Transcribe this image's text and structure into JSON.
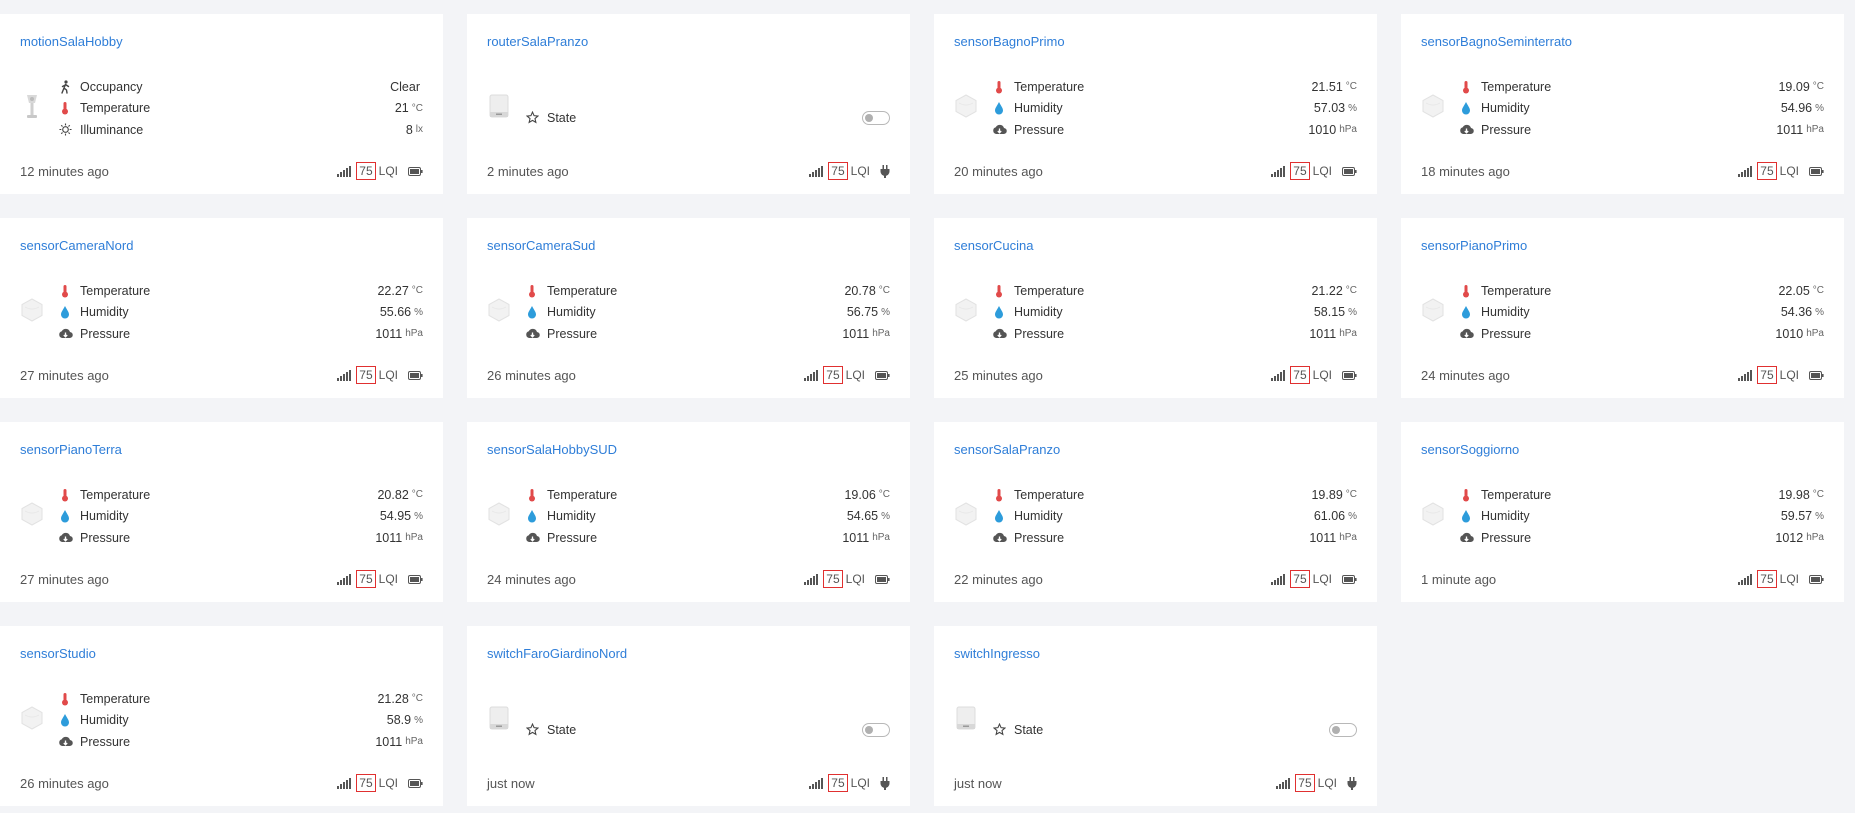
{
  "lqi_label": "LQI",
  "colors": {
    "link": "#2f7ed8",
    "thermo": "#e14a4a",
    "drop": "#2d9cdb",
    "highlight": "#e03030"
  },
  "cards": [
    {
      "title": "motionSalaHobby",
      "image": "motion-sensor",
      "power": "battery",
      "time": "12 minutes ago",
      "lqi": "75",
      "props": [
        {
          "icon": "walking-person-icon",
          "label": "Occupancy",
          "value": "Clear",
          "unit": ""
        },
        {
          "icon": "thermometer-icon",
          "label": "Temperature",
          "value": "21",
          "unit": "°C"
        },
        {
          "icon": "sun-icon",
          "label": "Illuminance",
          "value": "8",
          "unit": "lx"
        }
      ]
    },
    {
      "title": "routerSalaPranzo",
      "image": "router",
      "power": "plug",
      "time": "2 minutes ago",
      "lqi": "75",
      "props": [
        {
          "icon": "star-icon",
          "label": "State",
          "toggle": true
        }
      ]
    },
    {
      "title": "sensorBagnoPrimo",
      "image": "climate-sensor",
      "power": "battery",
      "time": "20 minutes ago",
      "lqi": "75",
      "props": [
        {
          "icon": "thermometer-icon",
          "label": "Temperature",
          "value": "21.51",
          "unit": "°C"
        },
        {
          "icon": "drop-icon",
          "label": "Humidity",
          "value": "57.03",
          "unit": "%"
        },
        {
          "icon": "cloud-download-icon",
          "label": "Pressure",
          "value": "1010",
          "unit": "hPa"
        }
      ]
    },
    {
      "title": "sensorBagnoSeminterrato",
      "image": "climate-sensor",
      "power": "battery",
      "time": "18 minutes ago",
      "lqi": "75",
      "props": [
        {
          "icon": "thermometer-icon",
          "label": "Temperature",
          "value": "19.09",
          "unit": "°C"
        },
        {
          "icon": "drop-icon",
          "label": "Humidity",
          "value": "54.96",
          "unit": "%"
        },
        {
          "icon": "cloud-download-icon",
          "label": "Pressure",
          "value": "1011",
          "unit": "hPa"
        }
      ]
    },
    {
      "title": "sensorCameraNord",
      "image": "climate-sensor",
      "power": "battery",
      "time": "27 minutes ago",
      "lqi": "75",
      "props": [
        {
          "icon": "thermometer-icon",
          "label": "Temperature",
          "value": "22.27",
          "unit": "°C"
        },
        {
          "icon": "drop-icon",
          "label": "Humidity",
          "value": "55.66",
          "unit": "%"
        },
        {
          "icon": "cloud-download-icon",
          "label": "Pressure",
          "value": "1011",
          "unit": "hPa"
        }
      ]
    },
    {
      "title": "sensorCameraSud",
      "image": "climate-sensor",
      "power": "battery",
      "time": "26 minutes ago",
      "lqi": "75",
      "props": [
        {
          "icon": "thermometer-icon",
          "label": "Temperature",
          "value": "20.78",
          "unit": "°C"
        },
        {
          "icon": "drop-icon",
          "label": "Humidity",
          "value": "56.75",
          "unit": "%"
        },
        {
          "icon": "cloud-download-icon",
          "label": "Pressure",
          "value": "1011",
          "unit": "hPa"
        }
      ]
    },
    {
      "title": "sensorCucina",
      "image": "climate-sensor",
      "power": "battery",
      "time": "25 minutes ago",
      "lqi": "75",
      "props": [
        {
          "icon": "thermometer-icon",
          "label": "Temperature",
          "value": "21.22",
          "unit": "°C"
        },
        {
          "icon": "drop-icon",
          "label": "Humidity",
          "value": "58.15",
          "unit": "%"
        },
        {
          "icon": "cloud-download-icon",
          "label": "Pressure",
          "value": "1011",
          "unit": "hPa"
        }
      ]
    },
    {
      "title": "sensorPianoPrimo",
      "image": "climate-sensor",
      "power": "battery",
      "time": "24 minutes ago",
      "lqi": "75",
      "props": [
        {
          "icon": "thermometer-icon",
          "label": "Temperature",
          "value": "22.05",
          "unit": "°C"
        },
        {
          "icon": "drop-icon",
          "label": "Humidity",
          "value": "54.36",
          "unit": "%"
        },
        {
          "icon": "cloud-download-icon",
          "label": "Pressure",
          "value": "1010",
          "unit": "hPa"
        }
      ]
    },
    {
      "title": "sensorPianoTerra",
      "image": "climate-sensor",
      "power": "battery",
      "time": "27 minutes ago",
      "lqi": "75",
      "props": [
        {
          "icon": "thermometer-icon",
          "label": "Temperature",
          "value": "20.82",
          "unit": "°C"
        },
        {
          "icon": "drop-icon",
          "label": "Humidity",
          "value": "54.95",
          "unit": "%"
        },
        {
          "icon": "cloud-download-icon",
          "label": "Pressure",
          "value": "1011",
          "unit": "hPa"
        }
      ]
    },
    {
      "title": "sensorSalaHobbySUD",
      "image": "climate-sensor",
      "power": "battery",
      "time": "24 minutes ago",
      "lqi": "75",
      "props": [
        {
          "icon": "thermometer-icon",
          "label": "Temperature",
          "value": "19.06",
          "unit": "°C"
        },
        {
          "icon": "drop-icon",
          "label": "Humidity",
          "value": "54.65",
          "unit": "%"
        },
        {
          "icon": "cloud-download-icon",
          "label": "Pressure",
          "value": "1011",
          "unit": "hPa"
        }
      ]
    },
    {
      "title": "sensorSalaPranzo",
      "image": "climate-sensor",
      "power": "battery",
      "time": "22 minutes ago",
      "lqi": "75",
      "props": [
        {
          "icon": "thermometer-icon",
          "label": "Temperature",
          "value": "19.89",
          "unit": "°C"
        },
        {
          "icon": "drop-icon",
          "label": "Humidity",
          "value": "61.06",
          "unit": "%"
        },
        {
          "icon": "cloud-download-icon",
          "label": "Pressure",
          "value": "1011",
          "unit": "hPa"
        }
      ]
    },
    {
      "title": "sensorSoggiorno",
      "image": "climate-sensor",
      "power": "battery",
      "time": "1 minute ago",
      "lqi": "75",
      "props": [
        {
          "icon": "thermometer-icon",
          "label": "Temperature",
          "value": "19.98",
          "unit": "°C"
        },
        {
          "icon": "drop-icon",
          "label": "Humidity",
          "value": "59.57",
          "unit": "%"
        },
        {
          "icon": "cloud-download-icon",
          "label": "Pressure",
          "value": "1012",
          "unit": "hPa"
        }
      ]
    },
    {
      "title": "sensorStudio",
      "image": "climate-sensor",
      "power": "battery",
      "time": "26 minutes ago",
      "lqi": "75",
      "props": [
        {
          "icon": "thermometer-icon",
          "label": "Temperature",
          "value": "21.28",
          "unit": "°C"
        },
        {
          "icon": "drop-icon",
          "label": "Humidity",
          "value": "58.9",
          "unit": "%"
        },
        {
          "icon": "cloud-download-icon",
          "label": "Pressure",
          "value": "1011",
          "unit": "hPa"
        }
      ]
    },
    {
      "title": "switchFaroGiardinoNord",
      "image": "switch",
      "power": "plug",
      "time": "just now",
      "lqi": "75",
      "props": [
        {
          "icon": "star-icon",
          "label": "State",
          "toggle": true
        }
      ]
    },
    {
      "title": "switchIngresso",
      "image": "switch",
      "power": "plug",
      "time": "just now",
      "lqi": "75",
      "props": [
        {
          "icon": "star-icon",
          "label": "State",
          "toggle": true
        }
      ]
    }
  ]
}
